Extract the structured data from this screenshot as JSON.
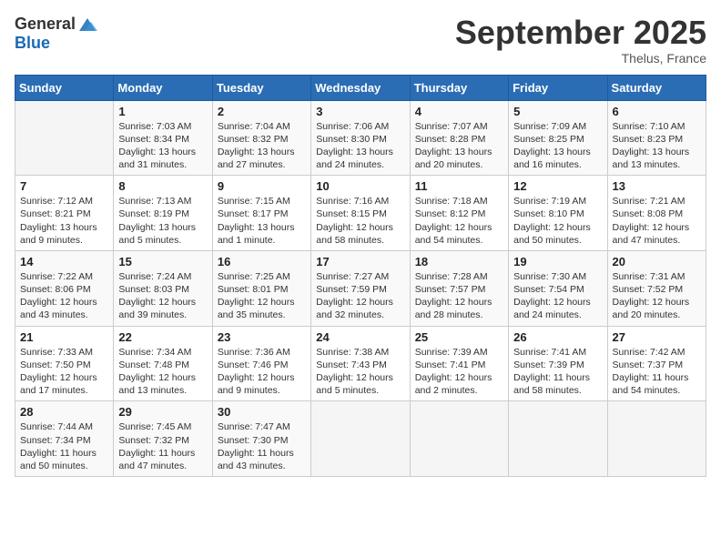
{
  "header": {
    "logo_general": "General",
    "logo_blue": "Blue",
    "month": "September 2025",
    "location": "Thelus, France"
  },
  "weekdays": [
    "Sunday",
    "Monday",
    "Tuesday",
    "Wednesday",
    "Thursday",
    "Friday",
    "Saturday"
  ],
  "weeks": [
    [
      {
        "day": "",
        "info": ""
      },
      {
        "day": "1",
        "info": "Sunrise: 7:03 AM\nSunset: 8:34 PM\nDaylight: 13 hours and 31 minutes."
      },
      {
        "day": "2",
        "info": "Sunrise: 7:04 AM\nSunset: 8:32 PM\nDaylight: 13 hours and 27 minutes."
      },
      {
        "day": "3",
        "info": "Sunrise: 7:06 AM\nSunset: 8:30 PM\nDaylight: 13 hours and 24 minutes."
      },
      {
        "day": "4",
        "info": "Sunrise: 7:07 AM\nSunset: 8:28 PM\nDaylight: 13 hours and 20 minutes."
      },
      {
        "day": "5",
        "info": "Sunrise: 7:09 AM\nSunset: 8:25 PM\nDaylight: 13 hours and 16 minutes."
      },
      {
        "day": "6",
        "info": "Sunrise: 7:10 AM\nSunset: 8:23 PM\nDaylight: 13 hours and 13 minutes."
      }
    ],
    [
      {
        "day": "7",
        "info": "Sunrise: 7:12 AM\nSunset: 8:21 PM\nDaylight: 13 hours and 9 minutes."
      },
      {
        "day": "8",
        "info": "Sunrise: 7:13 AM\nSunset: 8:19 PM\nDaylight: 13 hours and 5 minutes."
      },
      {
        "day": "9",
        "info": "Sunrise: 7:15 AM\nSunset: 8:17 PM\nDaylight: 13 hours and 1 minute."
      },
      {
        "day": "10",
        "info": "Sunrise: 7:16 AM\nSunset: 8:15 PM\nDaylight: 12 hours and 58 minutes."
      },
      {
        "day": "11",
        "info": "Sunrise: 7:18 AM\nSunset: 8:12 PM\nDaylight: 12 hours and 54 minutes."
      },
      {
        "day": "12",
        "info": "Sunrise: 7:19 AM\nSunset: 8:10 PM\nDaylight: 12 hours and 50 minutes."
      },
      {
        "day": "13",
        "info": "Sunrise: 7:21 AM\nSunset: 8:08 PM\nDaylight: 12 hours and 47 minutes."
      }
    ],
    [
      {
        "day": "14",
        "info": "Sunrise: 7:22 AM\nSunset: 8:06 PM\nDaylight: 12 hours and 43 minutes."
      },
      {
        "day": "15",
        "info": "Sunrise: 7:24 AM\nSunset: 8:03 PM\nDaylight: 12 hours and 39 minutes."
      },
      {
        "day": "16",
        "info": "Sunrise: 7:25 AM\nSunset: 8:01 PM\nDaylight: 12 hours and 35 minutes."
      },
      {
        "day": "17",
        "info": "Sunrise: 7:27 AM\nSunset: 7:59 PM\nDaylight: 12 hours and 32 minutes."
      },
      {
        "day": "18",
        "info": "Sunrise: 7:28 AM\nSunset: 7:57 PM\nDaylight: 12 hours and 28 minutes."
      },
      {
        "day": "19",
        "info": "Sunrise: 7:30 AM\nSunset: 7:54 PM\nDaylight: 12 hours and 24 minutes."
      },
      {
        "day": "20",
        "info": "Sunrise: 7:31 AM\nSunset: 7:52 PM\nDaylight: 12 hours and 20 minutes."
      }
    ],
    [
      {
        "day": "21",
        "info": "Sunrise: 7:33 AM\nSunset: 7:50 PM\nDaylight: 12 hours and 17 minutes."
      },
      {
        "day": "22",
        "info": "Sunrise: 7:34 AM\nSunset: 7:48 PM\nDaylight: 12 hours and 13 minutes."
      },
      {
        "day": "23",
        "info": "Sunrise: 7:36 AM\nSunset: 7:46 PM\nDaylight: 12 hours and 9 minutes."
      },
      {
        "day": "24",
        "info": "Sunrise: 7:38 AM\nSunset: 7:43 PM\nDaylight: 12 hours and 5 minutes."
      },
      {
        "day": "25",
        "info": "Sunrise: 7:39 AM\nSunset: 7:41 PM\nDaylight: 12 hours and 2 minutes."
      },
      {
        "day": "26",
        "info": "Sunrise: 7:41 AM\nSunset: 7:39 PM\nDaylight: 11 hours and 58 minutes."
      },
      {
        "day": "27",
        "info": "Sunrise: 7:42 AM\nSunset: 7:37 PM\nDaylight: 11 hours and 54 minutes."
      }
    ],
    [
      {
        "day": "28",
        "info": "Sunrise: 7:44 AM\nSunset: 7:34 PM\nDaylight: 11 hours and 50 minutes."
      },
      {
        "day": "29",
        "info": "Sunrise: 7:45 AM\nSunset: 7:32 PM\nDaylight: 11 hours and 47 minutes."
      },
      {
        "day": "30",
        "info": "Sunrise: 7:47 AM\nSunset: 7:30 PM\nDaylight: 11 hours and 43 minutes."
      },
      {
        "day": "",
        "info": ""
      },
      {
        "day": "",
        "info": ""
      },
      {
        "day": "",
        "info": ""
      },
      {
        "day": "",
        "info": ""
      }
    ]
  ]
}
